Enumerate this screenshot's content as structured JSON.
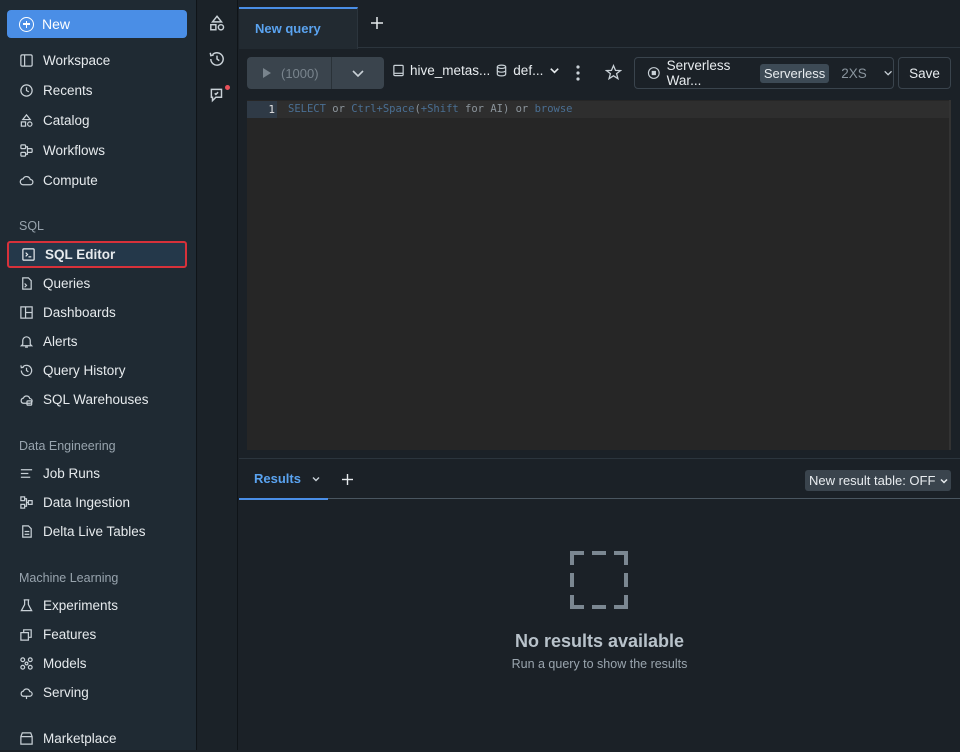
{
  "sidebar": {
    "new_label": "New",
    "top_items": [
      "Workspace",
      "Recents",
      "Catalog",
      "Workflows",
      "Compute"
    ],
    "sql_section": "SQL",
    "sql_items": [
      "SQL Editor",
      "Queries",
      "Dashboards",
      "Alerts",
      "Query History",
      "SQL Warehouses"
    ],
    "de_section": "Data Engineering",
    "de_items": [
      "Job Runs",
      "Data Ingestion",
      "Delta Live Tables"
    ],
    "ml_section": "Machine Learning",
    "ml_items": [
      "Experiments",
      "Features",
      "Models",
      "Serving"
    ],
    "bottom_items": [
      "Marketplace"
    ],
    "active_item": "SQL Editor"
  },
  "tabs": {
    "active_label": "New query"
  },
  "toolbar": {
    "run_label": "(1000)",
    "catalog": "hive_metas...",
    "schema": "def...",
    "warehouse": "Serverless War...",
    "warehouse_badge": "Serverless",
    "warehouse_size": "2XS",
    "save_label": "Save"
  },
  "editor": {
    "line_number": "1",
    "hint_parts": [
      {
        "text": "SELECT",
        "kind": "kw"
      },
      {
        "text": " or ",
        "kind": "plain"
      },
      {
        "text": "Ctrl+Space",
        "kind": "kw"
      },
      {
        "text": "(",
        "kind": "plain"
      },
      {
        "text": "+Shift",
        "kind": "kw"
      },
      {
        "text": " for AI) or ",
        "kind": "plain"
      },
      {
        "text": "browse",
        "kind": "kw"
      }
    ]
  },
  "results": {
    "tab_label": "Results",
    "toggle_label": "New result table: OFF",
    "empty_title": "No results available",
    "empty_subtitle": "Run a query to show the results"
  },
  "colors": {
    "accent": "#4a8ee6",
    "active_outline": "#d7313a",
    "background": "#1b2127",
    "sidebar": "#1f2a33"
  }
}
